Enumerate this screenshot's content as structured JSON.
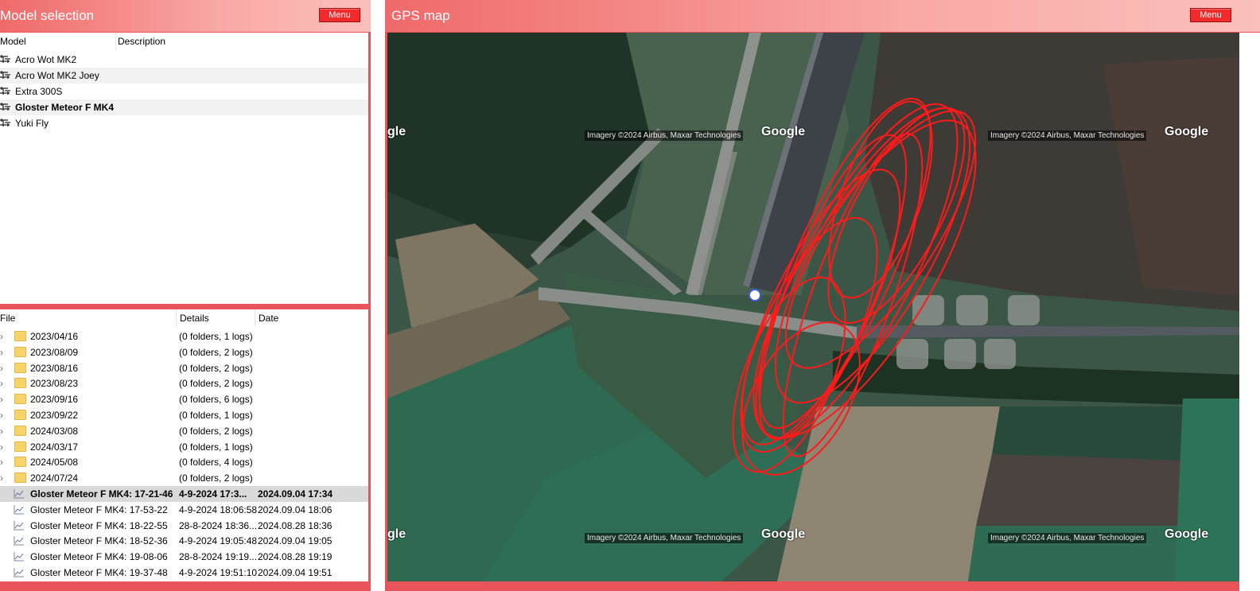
{
  "left_panel": {
    "title": "Model selection",
    "menu_label": "Menu",
    "models_table": {
      "columns": [
        "Model",
        "Description"
      ],
      "rows": [
        {
          "name": "Acro Wot MK2",
          "description": ""
        },
        {
          "name": "Acro Wot MK2 Joey",
          "description": ""
        },
        {
          "name": "Extra 300S",
          "description": ""
        },
        {
          "name": "Gloster Meteor F MK4",
          "description": "",
          "selected": true
        },
        {
          "name": "Yuki Fly",
          "description": ""
        }
      ]
    },
    "files_table": {
      "columns": [
        "File",
        "Details",
        "Date"
      ],
      "folders": [
        {
          "name": "2023/04/16",
          "details": "(0 folders, 1 logs)"
        },
        {
          "name": "2023/08/09",
          "details": "(0 folders, 2 logs)"
        },
        {
          "name": "2023/08/16",
          "details": "(0 folders, 2 logs)"
        },
        {
          "name": "2023/08/23",
          "details": "(0 folders, 2 logs)"
        },
        {
          "name": "2023/09/16",
          "details": "(0 folders, 6 logs)"
        },
        {
          "name": "2023/09/22",
          "details": "(0 folders, 1 logs)"
        },
        {
          "name": "2024/03/08",
          "details": "(0 folders, 2 logs)"
        },
        {
          "name": "2024/03/17",
          "details": "(0 folders, 1 logs)"
        },
        {
          "name": "2024/05/08",
          "details": "(0 folders, 4 logs)"
        },
        {
          "name": "2024/07/24",
          "details": "(0 folders, 2 logs)"
        }
      ],
      "logs": [
        {
          "name": "Gloster Meteor F MK4: 17-21-46",
          "details": "4-9-2024 17:3...",
          "date": "2024.09.04 17:34",
          "selected": true
        },
        {
          "name": "Gloster Meteor F MK4: 17-53-22",
          "details": "4-9-2024 18:06:58",
          "date": "2024.09.04 18:06"
        },
        {
          "name": "Gloster Meteor F MK4: 18-22-55",
          "details": "28-8-2024 18:36...",
          "date": "2024.08.28 18:36"
        },
        {
          "name": "Gloster Meteor F MK4: 18-52-36",
          "details": "4-9-2024 19:05:48",
          "date": "2024.09.04 19:05"
        },
        {
          "name": "Gloster Meteor F MK4: 19-08-06",
          "details": "28-8-2024 19:19...",
          "date": "2024.08.28 19:19"
        },
        {
          "name": "Gloster Meteor F MK4: 19-37-48",
          "details": "4-9-2024 19:51:10",
          "date": "2024.09.04 19:51"
        }
      ]
    }
  },
  "right_panel": {
    "title": "GPS map",
    "menu_label": "Menu",
    "map": {
      "attribution": "Imagery ©2024 Airbus, Maxar Technologies",
      "logo": "Google",
      "logo_partial": "gle",
      "track_color": "#ff1a1a",
      "marker_color": "#ffffff"
    }
  },
  "colors": {
    "panel_border": "#e8545a",
    "menu_button": "#f12b2b",
    "header_gradient_start": "#ef6a6a",
    "header_gradient_end": "#fbc0bb"
  }
}
